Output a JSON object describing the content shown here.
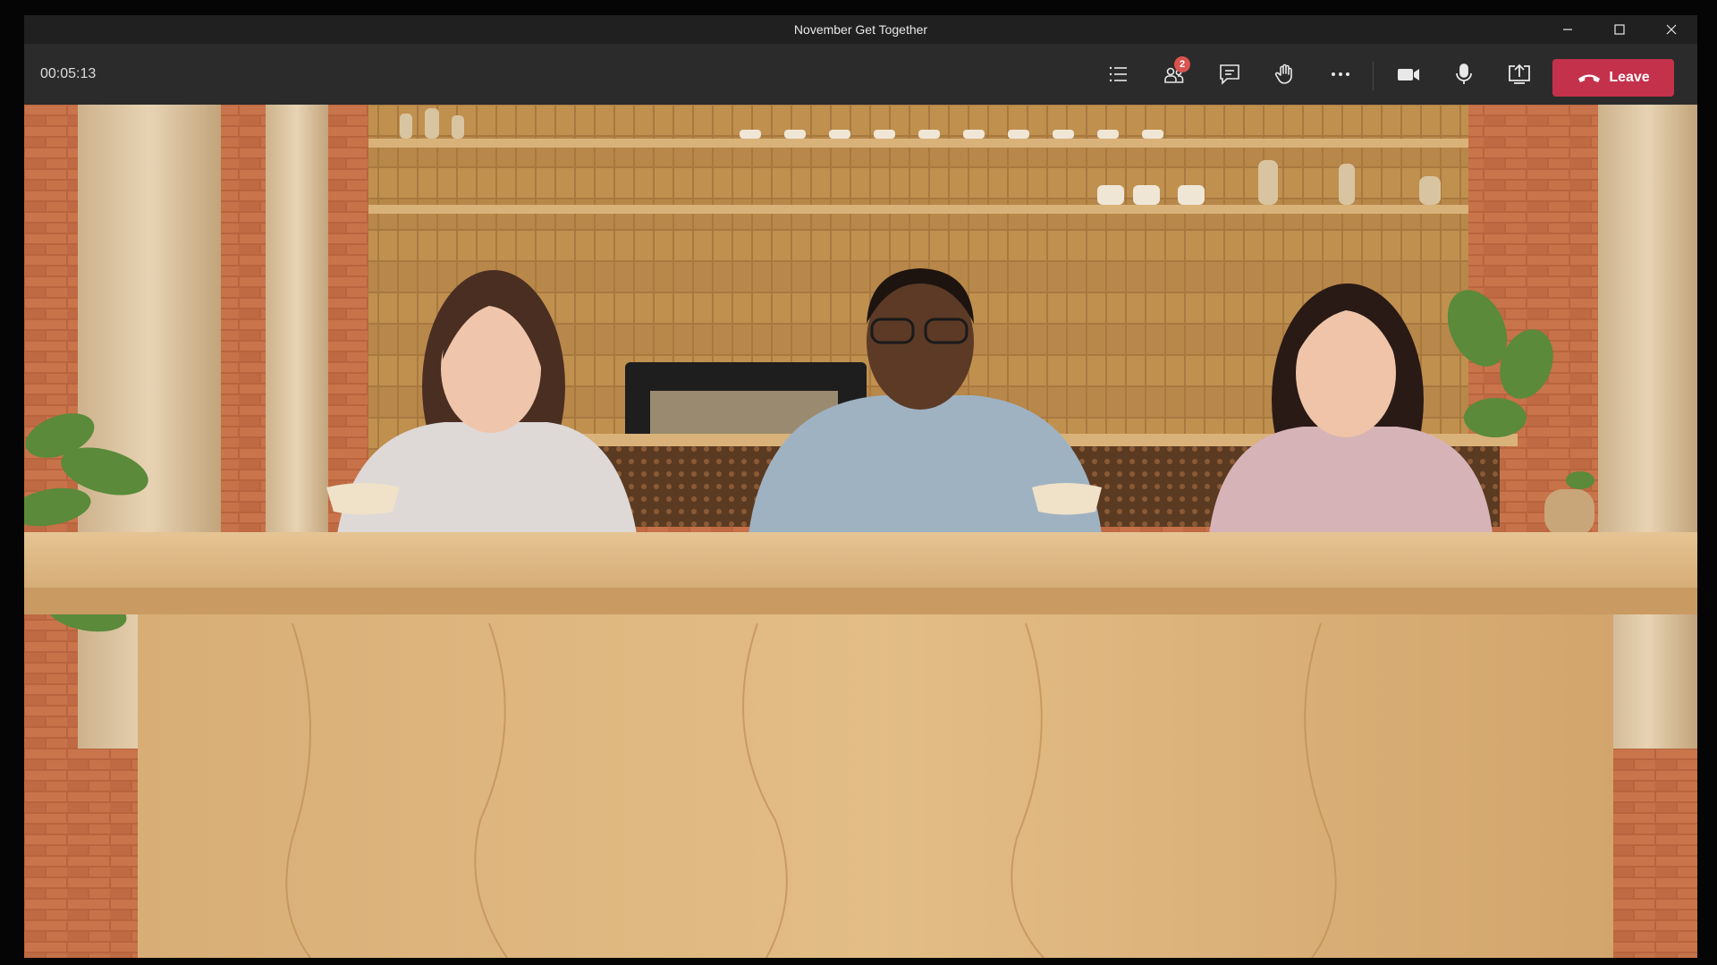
{
  "window": {
    "title": "November Get Together"
  },
  "toolbar": {
    "timer": "00:05:13",
    "participants_badge": "2",
    "leave_label": "Leave",
    "icons": [
      "list-icon",
      "participants-icon",
      "chat-icon",
      "raise-hand-icon",
      "more-icon",
      "camera-icon",
      "microphone-icon",
      "share-screen-icon",
      "phone-hangup-icon"
    ]
  },
  "colors": {
    "leave": "#c4314b",
    "badge": "#d9534f",
    "toolbar": "#2b2b2b",
    "titlebar": "#202020"
  }
}
